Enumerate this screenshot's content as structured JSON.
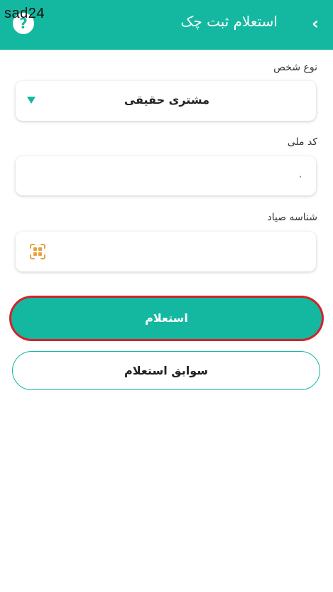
{
  "watermark": "sad24",
  "header": {
    "title": "استعلام ثبت چک",
    "back_icon": "chevron-right-icon",
    "help_icon": "question-icon",
    "help_glyph": "?",
    "background": "#14b8a0"
  },
  "form": {
    "person_type": {
      "label": "نوع شخص",
      "value": "مشتری حقیقی"
    },
    "national_code": {
      "label": "کد ملی",
      "value": "",
      "placeholder": "۰"
    },
    "sayad_id": {
      "label": "شناسه صیاد",
      "value": "",
      "icon": "qr-scan-icon"
    }
  },
  "buttons": {
    "inquiry": "استعلام",
    "history": "سوابق استعلام"
  },
  "colors": {
    "accent": "#14b8a0",
    "highlight_border": "#d2232a",
    "scan_icon": "#e6a23c"
  }
}
